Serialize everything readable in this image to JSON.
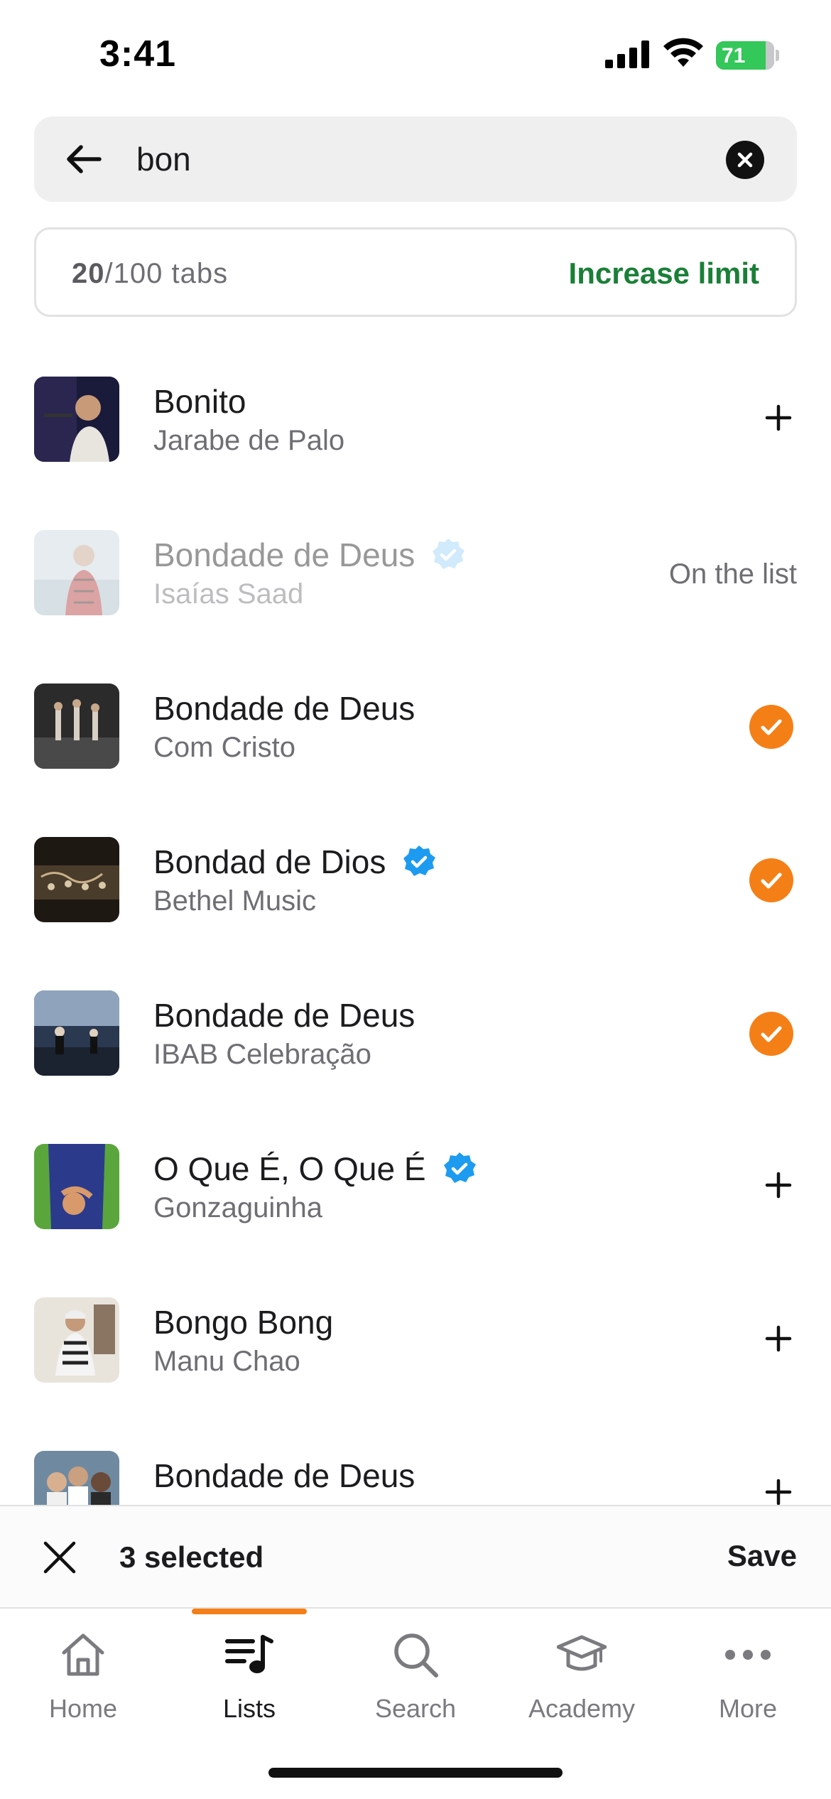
{
  "status_bar": {
    "time": "3:41",
    "battery": "71"
  },
  "search": {
    "value": "bon",
    "placeholder": ""
  },
  "limit": {
    "count": "20",
    "total": "/100 tabs",
    "action": "Increase limit"
  },
  "songs": [
    {
      "title": "Bonito",
      "artist": "Jarabe de Palo",
      "verified": false,
      "state": "add"
    },
    {
      "title": "Bondade de Deus",
      "artist": "Isaías Saad",
      "verified": true,
      "state": "on_list",
      "state_label": "On the list"
    },
    {
      "title": "Bondade de Deus",
      "artist": "Com Cristo",
      "verified": false,
      "state": "selected"
    },
    {
      "title": "Bondad de Dios",
      "artist": "Bethel Music",
      "verified": true,
      "state": "selected"
    },
    {
      "title": "Bondade de Deus",
      "artist": "IBAB Celebração",
      "verified": false,
      "state": "selected"
    },
    {
      "title": "O Que É, O Que É",
      "artist": "Gonzaguinha",
      "verified": true,
      "state": "add"
    },
    {
      "title": "Bongo Bong",
      "artist": "Manu Chao",
      "verified": false,
      "state": "add"
    },
    {
      "title": "Bondade de Deus",
      "artist": "",
      "verified": false,
      "state": "add"
    }
  ],
  "selection": {
    "text": "3 selected",
    "save_label": "Save"
  },
  "tabs": [
    {
      "label": "Home",
      "icon": "home-icon"
    },
    {
      "label": "Lists",
      "icon": "lists-icon",
      "active": true
    },
    {
      "label": "Search",
      "icon": "search-icon"
    },
    {
      "label": "Academy",
      "icon": "academy-icon"
    },
    {
      "label": "More",
      "icon": "more-icon"
    }
  ],
  "colors": {
    "accent": "#f57f17",
    "link_green": "#1a7f37",
    "verified_blue": "#1d9bf0",
    "battery_green": "#34c759"
  }
}
